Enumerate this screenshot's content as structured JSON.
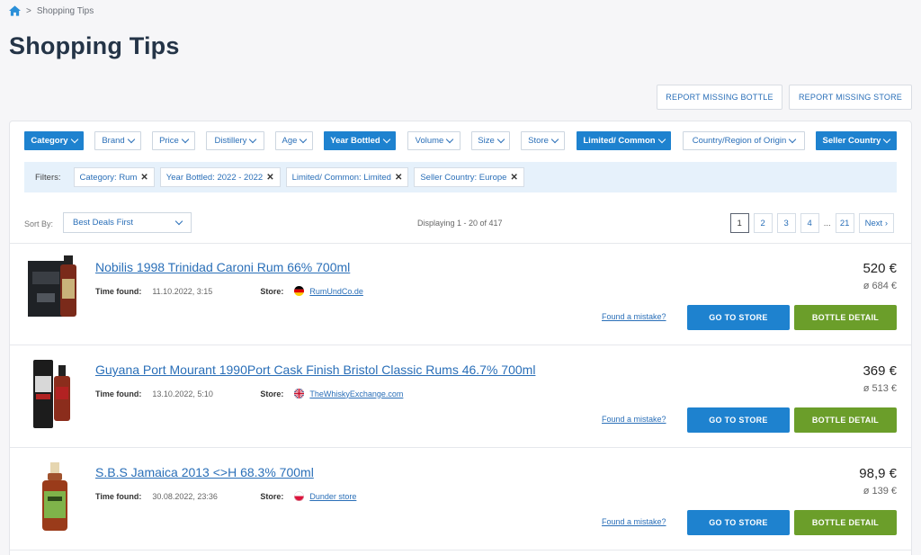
{
  "breadcrumb": {
    "separator": ">",
    "current": "Shopping Tips"
  },
  "page_title": "Shopping Tips",
  "report": {
    "bottle": "REPORT MISSING BOTTLE",
    "store": "REPORT MISSING STORE"
  },
  "filters": [
    {
      "label": "Category",
      "active": true
    },
    {
      "label": "Brand",
      "active": false
    },
    {
      "label": "Price",
      "active": false
    },
    {
      "label": "Distillery",
      "active": false
    },
    {
      "label": "Age",
      "active": false
    },
    {
      "label": "Year Bottled",
      "active": true
    },
    {
      "label": "Volume",
      "active": false
    },
    {
      "label": "Size",
      "active": false
    },
    {
      "label": "Store",
      "active": false
    },
    {
      "label": "Limited/ Common",
      "active": true
    },
    {
      "label": "Country/Region of Origin",
      "active": false
    },
    {
      "label": "Seller Country",
      "active": true
    }
  ],
  "active_filters": {
    "label": "Filters:",
    "chips": [
      "Category: Rum",
      "Year Bottled: 2022 - 2022",
      "Limited/ Common: Limited",
      "Seller Country: Europe"
    ]
  },
  "sort": {
    "label": "Sort By:",
    "value": "Best Deals First"
  },
  "displaying": "Displaying 1 - 20 of 417",
  "pagination": {
    "pages": [
      "1",
      "2",
      "3",
      "4"
    ],
    "dots": "...",
    "last": "21",
    "next": "Next ›",
    "current": "1"
  },
  "labels": {
    "time_found": "Time found:",
    "store": "Store:",
    "mistake": "Found a mistake?",
    "goto": "GO TO STORE",
    "detail": "BOTTLE DETAIL"
  },
  "items": [
    {
      "name": "Nobilis 1998 Trinidad Caroni Rum 66% 700ml",
      "time": "11.10.2022, 3:15",
      "store": "RumUndCo.de",
      "flag": "germany-flag-icon",
      "price": "520 €",
      "avg": "ø 684 €"
    },
    {
      "name": "Guyana Port Mourant 1990Port Cask Finish Bristol Classic Rums 46.7% 700ml",
      "time": "13.10.2022, 5:10",
      "store": "TheWhiskyExchange.com",
      "flag": "uk-flag-icon",
      "price": "369 €",
      "avg": "ø 513 €"
    },
    {
      "name": "S.B.S Jamaica 2013 <>H 68.3% 700ml",
      "time": "30.08.2022, 23:36",
      "store": "Dunder store",
      "flag": "poland-flag-icon",
      "price": "98,9 €",
      "avg": "ø 139 €"
    }
  ]
}
